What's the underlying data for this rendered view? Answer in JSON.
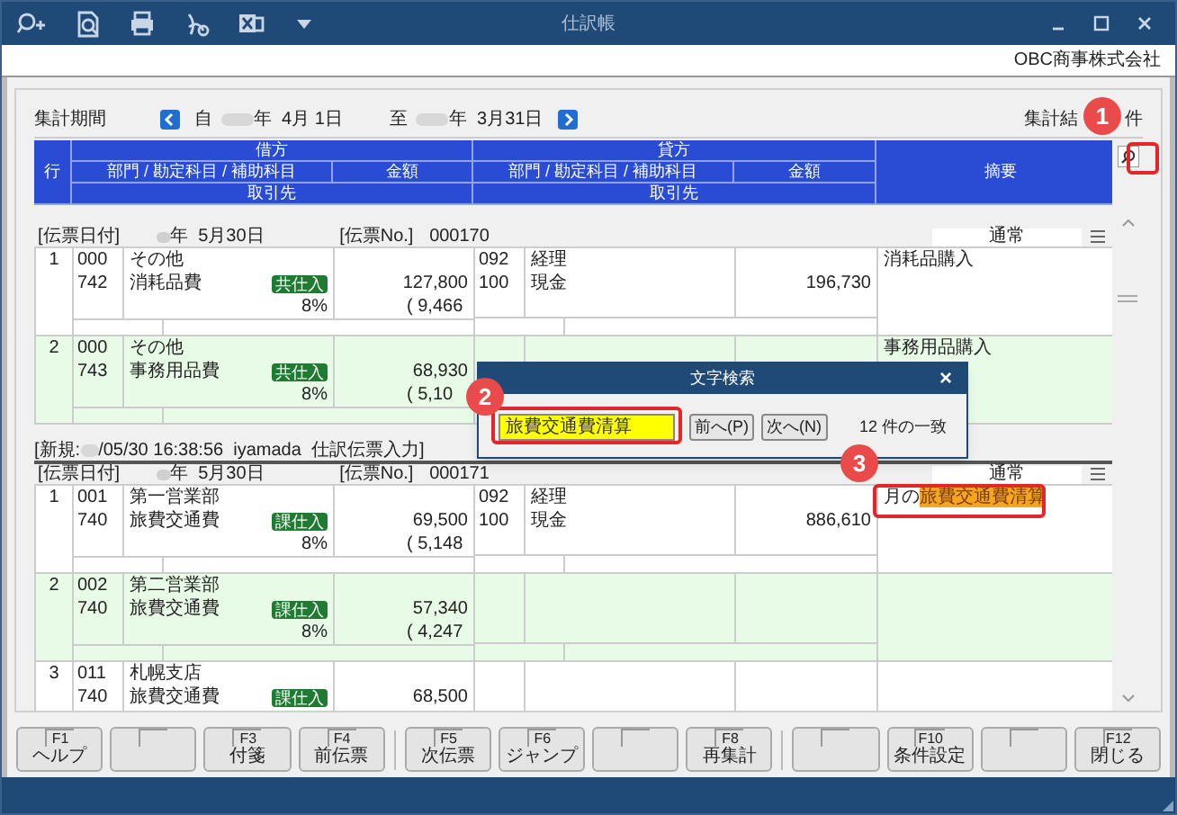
{
  "window": {
    "title": "仕訳帳"
  },
  "company": "OBC商事株式会社",
  "period": {
    "label": "集計期間",
    "from_prefix": "自",
    "from_date": "年  4月 1日",
    "to_prefix": "至",
    "to_date": "年  3月31日"
  },
  "result": {
    "label": "集計結",
    "suffix": "件"
  },
  "table": {
    "row_header": "行",
    "memo_header": "摘要",
    "debit": {
      "title": "借方",
      "account_header": "部門 / 勘定科目 / 補助科目",
      "amount_header": "金額",
      "partner_header": "取引先"
    },
    "credit": {
      "title": "貸方",
      "account_header": "部門 / 勘定科目 / 補助科目",
      "amount_header": "金額",
      "partner_header": "取引先"
    }
  },
  "entries": [
    {
      "date_label": "[伝票日付]",
      "date": "年  5月30日",
      "no_label": "[伝票No.]",
      "no": "000170",
      "type": "通常",
      "lines": [
        {
          "row": "1",
          "shaded": false,
          "debit": {
            "dept_code": "000",
            "dept_name": "その他",
            "account_code": "742",
            "account_name": "消耗品費",
            "tax_tag": "共仕入",
            "tax_rate": "8%",
            "amount": "127,800",
            "tax_amount": "( 9,466"
          },
          "credit": {
            "dept_code": "092",
            "dept_name": "経理",
            "account_code": "100",
            "account_name": "現金",
            "amount": "196,730"
          },
          "memo": [
            {
              "text": "消耗品購入",
              "highlighted": false
            }
          ]
        },
        {
          "row": "2",
          "shaded": true,
          "debit": {
            "dept_code": "000",
            "dept_name": "その他",
            "account_code": "743",
            "account_name": "事務用品費",
            "tax_tag": "共仕入",
            "tax_rate": "8%",
            "amount": "68,930",
            "tax_amount": "( 5,10"
          },
          "memo": [
            {
              "text": "事務用品購入",
              "highlighted": false
            }
          ]
        }
      ]
    },
    {
      "created_prefix": "[新規:",
      "created": "/05/30 16:38:56  iyamada  仕訳伝票入力]",
      "date_label": "[伝票日付]",
      "date": "年  5月30日",
      "no_label": "[伝票No.]",
      "no": "000171",
      "type": "通常",
      "lines": [
        {
          "row": "1",
          "shaded": false,
          "debit": {
            "dept_code": "001",
            "dept_name": "第一営業部",
            "account_code": "740",
            "account_name": "旅費交通費",
            "tax_tag": "課仕入",
            "tax_rate": "8%",
            "amount": "69,500",
            "tax_amount": "( 5,148"
          },
          "credit": {
            "dept_code": "092",
            "dept_name": "経理",
            "account_code": "100",
            "account_name": "現金",
            "amount": "886,610"
          },
          "memo": [
            {
              "text": "月の",
              "highlighted": false
            },
            {
              "text": "旅費交通費清算",
              "highlighted": true
            }
          ]
        },
        {
          "row": "2",
          "shaded": true,
          "debit": {
            "dept_code": "002",
            "dept_name": "第二営業部",
            "account_code": "740",
            "account_name": "旅費交通費",
            "tax_tag": "課仕入",
            "tax_rate": "8%",
            "amount": "57,340",
            "tax_amount": "( 4,247"
          }
        },
        {
          "row": "3",
          "shaded": false,
          "debit": {
            "dept_code": "011",
            "dept_name": "札幌支店",
            "account_code": "740",
            "account_name": "旅費交通費",
            "tax_tag": "課仕入",
            "amount": "68,500"
          }
        }
      ]
    }
  ],
  "search_dialog": {
    "title": "文字検索",
    "close": "×",
    "query": "旅費交通費清算",
    "prev_button": "前へ(P)",
    "next_button": "次へ(N)",
    "result": "12 件の一致"
  },
  "callouts": [
    {
      "number": "1",
      "kind": "search"
    },
    {
      "number": "2",
      "kind": "query"
    },
    {
      "number": "3",
      "kind": "memo"
    }
  ],
  "function_keys": [
    [
      {
        "kind": "key",
        "key": "F1",
        "label": "ヘルプ"
      },
      {
        "kind": "blank"
      },
      {
        "kind": "key",
        "key": "F3",
        "label": "付箋"
      },
      {
        "kind": "key",
        "key": "F4",
        "label": "前伝票"
      }
    ],
    [
      {
        "kind": "key",
        "key": "F5",
        "label": "次伝票"
      },
      {
        "kind": "key",
        "key": "F6",
        "label": "ジャンプ"
      },
      {
        "kind": "blank"
      },
      {
        "kind": "key",
        "key": "F8",
        "label": "再集計"
      }
    ],
    [
      {
        "kind": "blank"
      },
      {
        "kind": "key",
        "key": "F10",
        "label": "条件設定"
      },
      {
        "kind": "blank"
      },
      {
        "kind": "key",
        "key": "F12",
        "label": "閉じる"
      }
    ]
  ]
}
